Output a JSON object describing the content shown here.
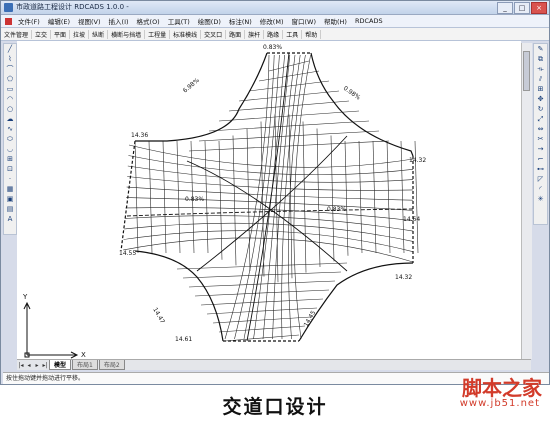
{
  "window": {
    "title": "市政道路工程设计 RDCADS 1.0.0 -",
    "controls": [
      "_",
      "□",
      "×"
    ]
  },
  "menu": {
    "items": [
      "文件(F)",
      "编辑(E)",
      "视图(V)",
      "插入(I)",
      "格式(O)",
      "工具(T)",
      "绘图(D)",
      "标注(N)",
      "修改(M)",
      "窗口(W)",
      "帮助(H)",
      "RDCADS"
    ]
  },
  "toolbar": {
    "items": [
      "文件管理",
      "立交",
      "平面",
      "拉坡",
      "纵断",
      "横断与挡墙",
      "工程量",
      "标准模线",
      "交叉口",
      "路面",
      "旗杆",
      "路缘",
      "工具",
      "帮助"
    ]
  },
  "left_tools": [
    "line-icon",
    "polyline-icon",
    "arc-icon",
    "polygon-icon",
    "rectangle-icon",
    "arc2-icon",
    "circle-icon",
    "revcloud-icon",
    "spline-icon",
    "ellipse-icon",
    "ellipse-arc-icon",
    "insert-block-icon",
    "make-block-icon",
    "point-icon",
    "hatch-icon",
    "region-icon",
    "table-icon",
    "text-icon"
  ],
  "left_tool_glyphs": [
    "╱",
    "⌇",
    "⌒",
    "⬠",
    "▭",
    "◠",
    "○",
    "☁",
    "∿",
    "⬭",
    "◡",
    "⊞",
    "⊡",
    "·",
    "▦",
    "▣",
    "▤",
    "A"
  ],
  "right_tools": [
    "erase-icon",
    "copy-icon",
    "mirror-icon",
    "offset-icon",
    "array-icon",
    "move-icon",
    "rotate-icon",
    "scale-icon",
    "stretch-icon",
    "trim-icon",
    "extend-icon",
    "break-icon",
    "join-icon",
    "chamfer-icon",
    "fillet-icon",
    "explode-icon"
  ],
  "right_tool_glyphs": [
    "✎",
    "⧉",
    "⟛",
    "⫽",
    "⊞",
    "✥",
    "↻",
    "⤢",
    "⇔",
    "✂",
    "→",
    "⌐",
    "⊷",
    "◸",
    "◜",
    "✳"
  ],
  "drawing": {
    "elevation_labels": [
      "14.36",
      "14.32",
      "14.64",
      "14.55",
      "14.32",
      "14.61"
    ],
    "grade_labels": [
      "0.83%",
      "0.83%",
      "0.83%"
    ],
    "rotated_labels": [
      "6.98%",
      "0.98%",
      "14.45",
      "14.47"
    ]
  },
  "tabs": {
    "active": "模型",
    "layouts": [
      "布局1",
      "布局2"
    ]
  },
  "command": {
    "text": "按住拖动键并拖动进行平移。"
  },
  "caption": "交道口设计",
  "watermark": {
    "main": "脚本之家",
    "url": "www.jb51.net"
  }
}
